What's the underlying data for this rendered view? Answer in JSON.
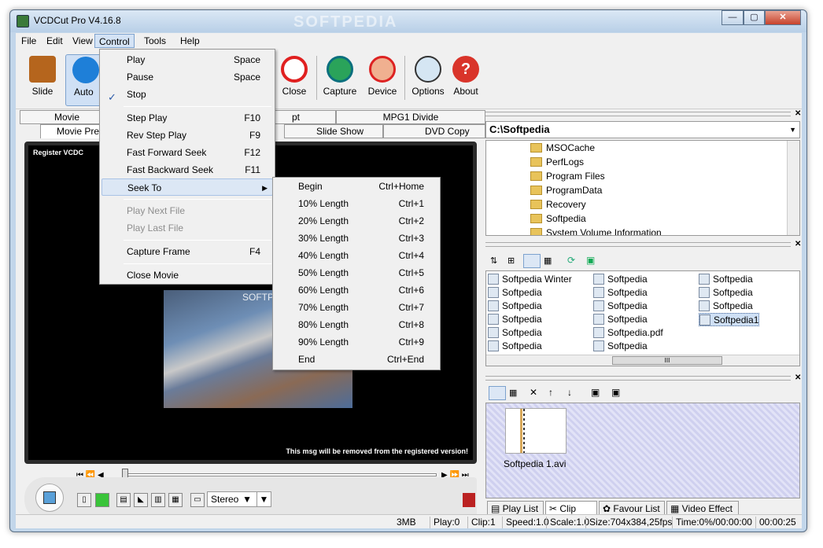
{
  "window": {
    "title": "VCDCut Pro V4.16.8",
    "watermark": "SOFTPEDIA"
  },
  "menubar": [
    "File",
    "Edit",
    "View",
    "Control",
    "Tools",
    "Help"
  ],
  "toolbar": {
    "slide": "Slide",
    "auto": "Auto",
    "close": "Close",
    "capture": "Capture",
    "device": "Device",
    "options": "Options",
    "about": "About"
  },
  "tabs_top": {
    "movie": "Movie",
    "pt": "pt",
    "mpg1": "MPG1 Divide"
  },
  "tabs_second": {
    "movie_pre": "Movie Pre",
    "slide_show": "Slide Show",
    "dvd_copy": "DVD Copy"
  },
  "video": {
    "register_text": "Register VCDC",
    "registered_msg": "This msg will be removed from the registered version!",
    "frame_text": "SOFTPEDIA"
  },
  "audio_mode": "Stereo",
  "control_menu": {
    "items": [
      {
        "label": "Play",
        "shortcut": "Space"
      },
      {
        "label": "Pause",
        "shortcut": "Space"
      },
      {
        "label": "Stop",
        "shortcut": ""
      },
      {
        "label": "Step Play",
        "shortcut": "F10"
      },
      {
        "label": "Rev Step Play",
        "shortcut": "F9"
      },
      {
        "label": "Fast Forward Seek",
        "shortcut": "F12"
      },
      {
        "label": "Fast Backward Seek",
        "shortcut": "F11"
      },
      {
        "label": "Seek To",
        "shortcut": ""
      },
      {
        "label": "Play Next File",
        "shortcut": ""
      },
      {
        "label": "Play Last File",
        "shortcut": ""
      },
      {
        "label": "Capture Frame",
        "shortcut": "F4"
      },
      {
        "label": "Close Movie",
        "shortcut": ""
      }
    ]
  },
  "seek_menu": {
    "items": [
      {
        "label": "Begin",
        "shortcut": "Ctrl+Home"
      },
      {
        "label": "10% Length",
        "shortcut": "Ctrl+1"
      },
      {
        "label": "20% Length",
        "shortcut": "Ctrl+2"
      },
      {
        "label": "30% Length",
        "shortcut": "Ctrl+3"
      },
      {
        "label": "40% Length",
        "shortcut": "Ctrl+4"
      },
      {
        "label": "50% Length",
        "shortcut": "Ctrl+5"
      },
      {
        "label": "60% Length",
        "shortcut": "Ctrl+6"
      },
      {
        "label": "70% Length",
        "shortcut": "Ctrl+7"
      },
      {
        "label": "80% Length",
        "shortcut": "Ctrl+8"
      },
      {
        "label": "90% Length",
        "shortcut": "Ctrl+9"
      },
      {
        "label": "End",
        "shortcut": "Ctrl+End"
      }
    ]
  },
  "explorer": {
    "path": "C:\\Softpedia",
    "folders": [
      "MSOCache",
      "PerfLogs",
      "Program Files",
      "ProgramData",
      "Recovery",
      "Softpedia",
      "System Volume Information"
    ]
  },
  "files": {
    "col1": [
      "Softpedia Winter",
      "Softpedia",
      "Softpedia",
      "Softpedia",
      "Softpedia",
      "Softpedia"
    ],
    "col2": [
      "Softpedia",
      "Softpedia",
      "Softpedia",
      "Softpedia",
      "Softpedia.pdf",
      "Softpedia"
    ],
    "col3": [
      "Softpedia",
      "Softpedia",
      "Softpedia",
      "Softpedia1"
    ],
    "scroll_grip": "III"
  },
  "clip": {
    "name": "Softpedia 1.avi"
  },
  "bottom_tabs": [
    "Play List",
    "Clip List",
    "Favour List",
    "Video Effect"
  ],
  "status": {
    "size": "3MB",
    "play": "Play:0",
    "clip": "Clip:1",
    "speed": "Speed:1.0",
    "scale": "Scale:1.0",
    "format": "Size:704x384,25fps",
    "time": "Time:0%/00:00:00",
    "duration": "00:00:25"
  },
  "colors": {
    "accent": "#0a64c8",
    "video_bg": "#000000",
    "clip_bg": "#d4d4f0"
  }
}
